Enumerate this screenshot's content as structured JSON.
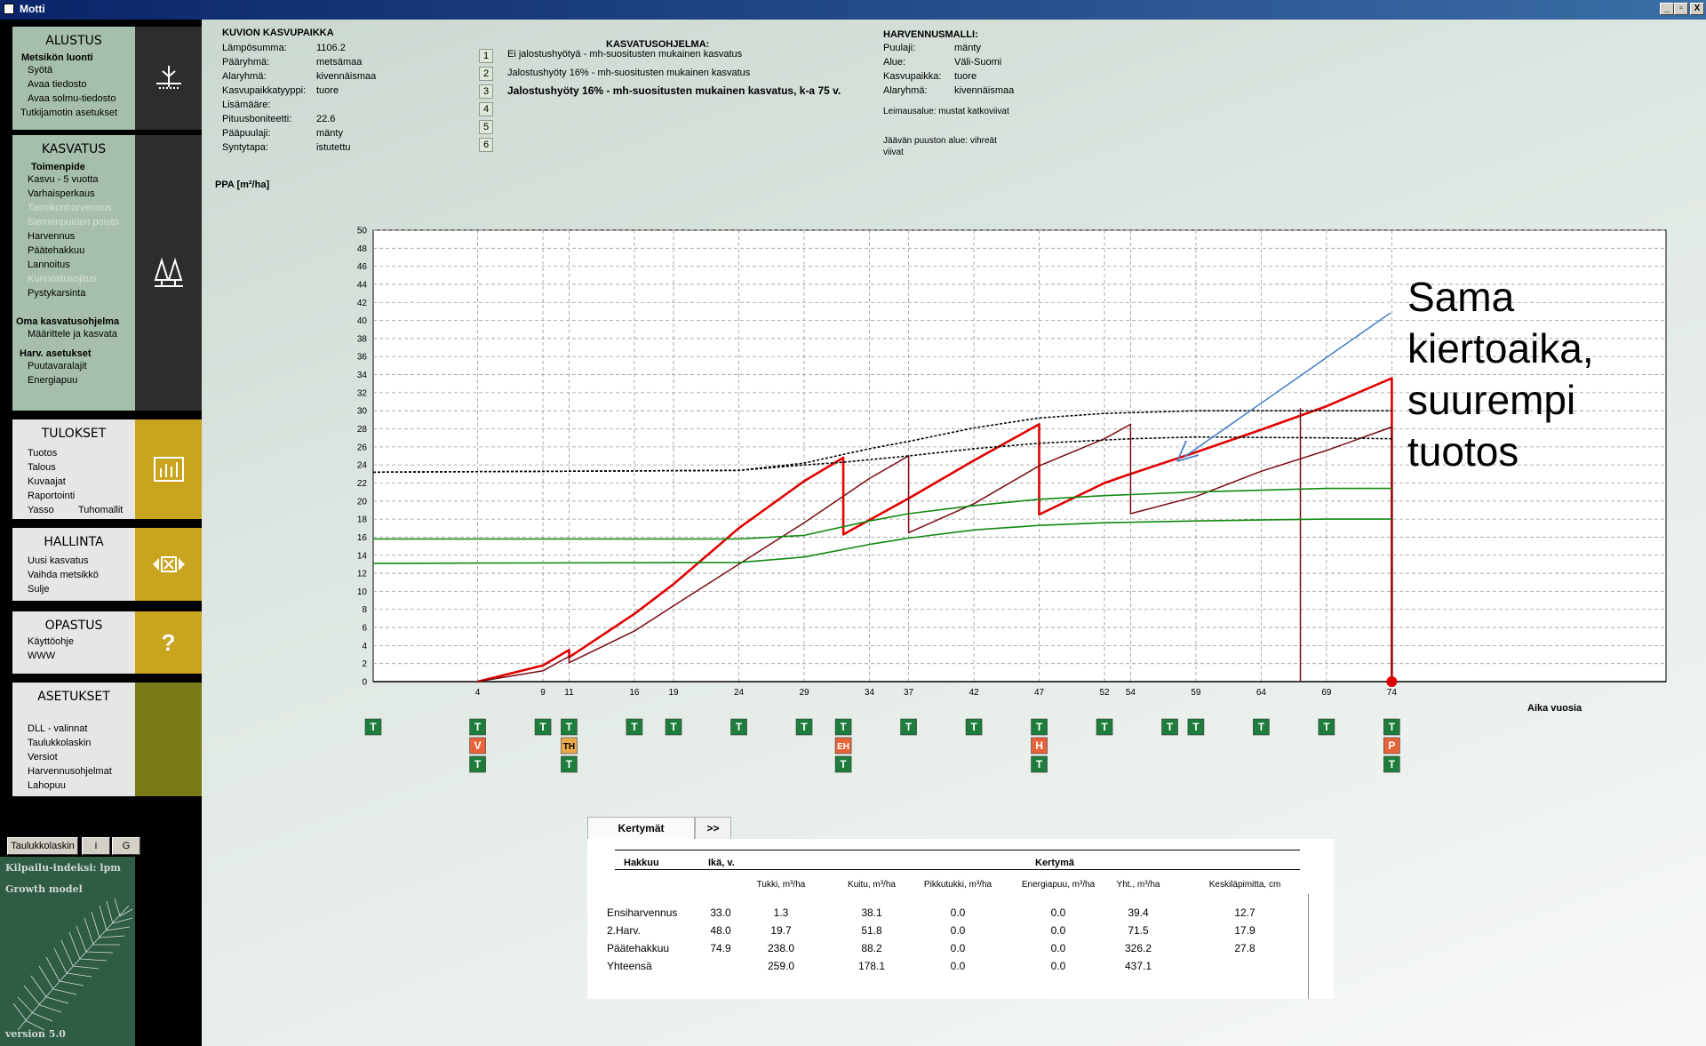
{
  "window": {
    "title": "Motti",
    "controls": [
      "_",
      "▫",
      "X"
    ]
  },
  "sidebar": {
    "alustus": {
      "title": "ALUSTUS",
      "group": "Metsikön luonti",
      "items": [
        "Syötä",
        "Avaa tiedosto",
        "Avaa solmu-tiedosto",
        "Tutkijamotin asetukset"
      ]
    },
    "kasvatus": {
      "title": "KASVATUS",
      "group": "Toimenpide",
      "items": [
        {
          "label": "Kasvu - 5 vuotta",
          "enabled": true
        },
        {
          "label": "Varhaisperkaus",
          "enabled": true
        },
        {
          "label": "Taimikonharvennus",
          "enabled": false
        },
        {
          "label": "Siemenpuiden poisto",
          "enabled": false
        },
        {
          "label": "Harvennus",
          "enabled": true
        },
        {
          "label": "Päätehakkuu",
          "enabled": true
        },
        {
          "label": "Lannoitus",
          "enabled": true
        },
        {
          "label": "Kunnostusojitus",
          "enabled": false
        },
        {
          "label": "Pystykarsinta",
          "enabled": true
        }
      ],
      "group2": "Oma kasvatusohjelma",
      "items2": [
        "Määrittele ja kasvata"
      ],
      "group3": "Harv. asetukset",
      "items3": [
        "Puutavaralajit",
        "Energiapuu"
      ]
    },
    "tulokset": {
      "title": "TULOKSET",
      "items": [
        "Tuotos",
        "Talous",
        "Kuvaajat",
        "Raportointi",
        "Yasso"
      ],
      "extra": "Tuhomallit"
    },
    "hallinta": {
      "title": "HALLINTA",
      "items": [
        "Uusi kasvatus",
        "Vaihda metsikkö",
        "Sulje"
      ]
    },
    "opastus": {
      "title": "OPASTUS",
      "items": [
        "Käyttöohje",
        "WWW"
      ],
      "icon_glyph": "?"
    },
    "asetukset": {
      "title": "ASETUKSET",
      "items": [
        "DLL - valinnat",
        "Taulukkolaskin",
        "Versiot",
        "Harvennusohjelmat",
        "Lahopuu"
      ]
    },
    "tools": {
      "taulukkolaskin": "Taulukkolaskin",
      "i": "i",
      "g": "G"
    },
    "panel": {
      "kilpailu": "Kilpailu-indeksi: lpm",
      "growth": "Growth model",
      "version": "version 5.0"
    }
  },
  "site": {
    "title": "KUVION KASVUPAIKKA",
    "rows": [
      {
        "k": "Lämpösumma:",
        "v": "1106.2"
      },
      {
        "k": "Pääryhmä:",
        "v": "metsämaa"
      },
      {
        "k": "Alaryhmä:",
        "v": "kivennäismaa"
      },
      {
        "k": "Kasvupaikkatyyppi:",
        "v": "tuore"
      },
      {
        "k": "Lisämääre:",
        "v": ""
      },
      {
        "k": "Pituusboniteetti:",
        "v": "22.6"
      },
      {
        "k": "Pääpuulaji:",
        "v": "mänty"
      },
      {
        "k": "Syntytapa:",
        "v": "istutettu"
      }
    ]
  },
  "program": {
    "title": "KASVATUSOHJELMA:",
    "lines": [
      "Ei jalostushyötyä - mh-suositusten mukainen kasvatus",
      "Jalostushyöty 16% - mh-suositusten mukainen kasvatus",
      "Jalostushyöty 16% - mh-suositusten mukainen kasvatus, k-a 75 v."
    ],
    "boxes": [
      "1",
      "2",
      "3",
      "4",
      "5",
      "6"
    ]
  },
  "model": {
    "title": "HARVENNUSMALLI:",
    "rows": [
      {
        "k": "Puulaji:",
        "v": "mänty"
      },
      {
        "k": "Alue:",
        "v": "Väli-Suomi"
      },
      {
        "k": "Kasvupaikka:",
        "v": "tuore"
      },
      {
        "k": "Alaryhmä:",
        "v": "kivennäismaa"
      }
    ],
    "note1": "Leimausalue: mustat katkoviivat",
    "note2a": "Jäävän puuston alue: vihreät",
    "note2b": "viivat"
  },
  "chart_data": {
    "type": "line",
    "ylabel": "PPA [m²/ha]",
    "xlabel": "Aika vuosia",
    "ylim": [
      0,
      50
    ],
    "yticks": [
      0,
      2,
      4,
      6,
      8,
      10,
      12,
      14,
      16,
      18,
      20,
      22,
      24,
      26,
      28,
      30,
      32,
      34,
      36,
      38,
      40,
      42,
      44,
      46,
      48,
      50
    ],
    "xlim": [
      -4,
      95
    ],
    "xticks": [
      4,
      9,
      11,
      16,
      19,
      24,
      29,
      34,
      37,
      42,
      47,
      52,
      54,
      59,
      64,
      69,
      74
    ],
    "grid": true,
    "series": [
      {
        "color": "#e00000",
        "width": 2.6,
        "dash": "",
        "points": [
          [
            4,
            0
          ],
          [
            9,
            1.8
          ],
          [
            11,
            3.5
          ],
          [
            11,
            2.7
          ],
          [
            16,
            7.5
          ],
          [
            19,
            10.8
          ],
          [
            24,
            17
          ],
          [
            29,
            22.2
          ],
          [
            32,
            24.8
          ],
          [
            32,
            16.3
          ],
          [
            37,
            20.3
          ],
          [
            42,
            24.5
          ],
          [
            47,
            28.5
          ],
          [
            47,
            18.5
          ],
          [
            52,
            22
          ],
          [
            54,
            23
          ],
          [
            59,
            25.4
          ],
          [
            64,
            27.9
          ],
          [
            69,
            30.5
          ],
          [
            74,
            33.6
          ],
          [
            74,
            0
          ]
        ]
      },
      {
        "color": "#7a0a10",
        "width": 1.5,
        "dash": "",
        "points": [
          [
            4,
            0
          ],
          [
            9,
            1.2
          ],
          [
            11,
            2.8
          ],
          [
            11,
            2.1
          ],
          [
            16,
            5.6
          ],
          [
            19,
            8.4
          ],
          [
            24,
            13
          ],
          [
            29,
            17.6
          ],
          [
            34,
            22.5
          ],
          [
            37,
            25
          ],
          [
            37,
            16.5
          ],
          [
            42,
            19.7
          ],
          [
            47,
            23.9
          ],
          [
            52,
            26.9
          ],
          [
            54,
            28.5
          ],
          [
            54,
            18.6
          ],
          [
            59,
            20.5
          ],
          [
            64,
            23.3
          ],
          [
            69,
            25.6
          ],
          [
            74,
            28.2
          ],
          [
            74,
            0
          ]
        ]
      },
      {
        "color": "#7a0a10",
        "width": 1.5,
        "dash": "",
        "points": [
          [
            67,
            30.3
          ],
          [
            67,
            0
          ]
        ]
      },
      {
        "color": "#000000",
        "width": 1.6,
        "dash": "3,2",
        "points": [
          [
            -4,
            23.2
          ],
          [
            24,
            23.4
          ],
          [
            29,
            24.2
          ],
          [
            34,
            25.8
          ],
          [
            37,
            26.6
          ],
          [
            42,
            28.1
          ],
          [
            47,
            29.2
          ],
          [
            52,
            29.7
          ],
          [
            59,
            30.0
          ],
          [
            69,
            30.0
          ],
          [
            74,
            30.0
          ]
        ]
      },
      {
        "color": "#000000",
        "width": 1.6,
        "dash": "3,2",
        "points": [
          [
            -4,
            23.2
          ],
          [
            24,
            23.4
          ],
          [
            29,
            24
          ],
          [
            32,
            24.3
          ],
          [
            37,
            25
          ],
          [
            42,
            25.8
          ],
          [
            47,
            26.4
          ],
          [
            54,
            26.9
          ],
          [
            59,
            27.1
          ],
          [
            69,
            27
          ],
          [
            74,
            26.9
          ]
        ]
      },
      {
        "color": "#118811",
        "width": 1.6,
        "dash": "",
        "points": [
          [
            -4,
            15.8
          ],
          [
            24,
            15.8
          ],
          [
            29,
            16.2
          ],
          [
            34,
            17.8
          ],
          [
            37,
            18.6
          ],
          [
            42,
            19.5
          ],
          [
            47,
            20.2
          ],
          [
            52,
            20.6
          ],
          [
            59,
            21
          ],
          [
            64,
            21.2
          ],
          [
            69,
            21.4
          ],
          [
            74,
            21.4
          ]
        ]
      },
      {
        "color": "#118811",
        "width": 1.6,
        "dash": "",
        "points": [
          [
            -4,
            13.1
          ],
          [
            24,
            13.2
          ],
          [
            29,
            13.8
          ],
          [
            34,
            15.2
          ],
          [
            37,
            15.9
          ],
          [
            42,
            16.8
          ],
          [
            47,
            17.3
          ],
          [
            52,
            17.6
          ],
          [
            59,
            17.8
          ],
          [
            64,
            17.9
          ],
          [
            69,
            18
          ],
          [
            74,
            18
          ]
        ]
      }
    ],
    "end_marker": {
      "x": 74,
      "y": 0,
      "color": "#e00000"
    }
  },
  "events": [
    {
      "x": -4,
      "badges": [
        "T"
      ]
    },
    {
      "x": 4,
      "badges": [
        "T",
        "V",
        "T"
      ]
    },
    {
      "x": 9,
      "badges": [
        "T"
      ]
    },
    {
      "x": 11,
      "badges": [
        "T",
        "TH",
        "T"
      ]
    },
    {
      "x": 16,
      "badges": [
        "T"
      ]
    },
    {
      "x": 19,
      "badges": [
        "T"
      ]
    },
    {
      "x": 24,
      "badges": [
        "T"
      ]
    },
    {
      "x": 29,
      "badges": [
        "T"
      ]
    },
    {
      "x": 32,
      "badges": [
        "T",
        "EH",
        "T"
      ]
    },
    {
      "x": 37,
      "badges": [
        "T"
      ]
    },
    {
      "x": 42,
      "badges": [
        "T"
      ]
    },
    {
      "x": 47,
      "badges": [
        "T",
        "H",
        "T"
      ]
    },
    {
      "x": 52,
      "badges": [
        "T"
      ]
    },
    {
      "x": 57,
      "badges": [
        "T"
      ]
    },
    {
      "x": 59,
      "badges": [
        "T"
      ]
    },
    {
      "x": 64,
      "badges": [
        "T"
      ]
    },
    {
      "x": 69,
      "badges": [
        "T"
      ]
    },
    {
      "x": 74,
      "badges": [
        "T",
        "P",
        "T"
      ]
    }
  ],
  "badge_colors": {
    "T": "#1e7d3c",
    "V": "#e8633a",
    "TH": "#e8a84a",
    "EH": "#e8633a",
    "H": "#e8633a",
    "P": "#e8633a"
  },
  "annotation": {
    "lines": [
      "Sama",
      "kiertoaika,",
      "suurempi",
      "tuotos"
    ],
    "arrow_color": "#4a82c8"
  },
  "results": {
    "tab": "Kertymät",
    "more": ">>",
    "h_hakkuu": "Hakkuu",
    "h_ika": "Ikä, v.",
    "h_kertyma": "Kertymä",
    "cols": [
      "Tukki, m³/ha",
      "Kuitu, m³/ha",
      "Pikkutukki, m³/ha",
      "Energiapuu, m³/ha",
      "Yht., m³/ha",
      "Keskiläpimitta, cm"
    ],
    "rows": [
      {
        "name": "Ensiharvennus",
        "age": "33.0",
        "vals": [
          "1.3",
          "38.1",
          "0.0",
          "0.0",
          "39.4",
          "12.7"
        ]
      },
      {
        "name": "2.Harv.",
        "age": "48.0",
        "vals": [
          "19.7",
          "51.8",
          "0.0",
          "0.0",
          "71.5",
          "17.9"
        ]
      },
      {
        "name": "Päätehakkuu",
        "age": "74.9",
        "vals": [
          "238.0",
          "88.2",
          "0.0",
          "0.0",
          "326.2",
          "27.8"
        ]
      },
      {
        "name": "Yhteensä",
        "age": "",
        "vals": [
          "259.0",
          "178.1",
          "0.0",
          "0.0",
          "437.1",
          ""
        ]
      }
    ]
  }
}
